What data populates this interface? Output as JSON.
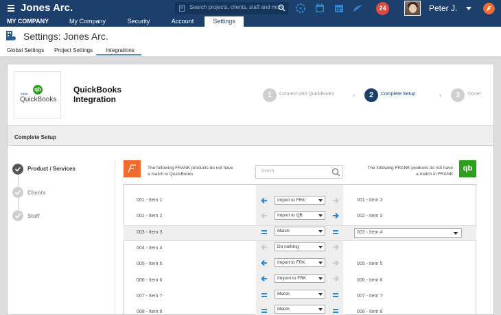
{
  "app": {
    "company_name": "Jones Arc.",
    "user_name": "Peter J.",
    "notification_count": "24"
  },
  "search": {
    "placeholder": "Search projects, clients, staff and more"
  },
  "nav": {
    "company_label": "MY COMPANY",
    "tabs": [
      {
        "label": "My Company"
      },
      {
        "label": "Security"
      },
      {
        "label": "Account"
      },
      {
        "label": "Settings",
        "active": true
      }
    ]
  },
  "page": {
    "title": "Settings: Jones Arc.",
    "subtabs": [
      {
        "label": "Global Settings"
      },
      {
        "label": "Project Settings"
      },
      {
        "label": "Integrations",
        "active": true
      }
    ]
  },
  "integration": {
    "logo_small_text": "intuit",
    "logo_text": "QuickBooks",
    "title_line1": "QuickBooks",
    "title_line2": "Integration",
    "steps": [
      {
        "number": "1",
        "label": "Connect with QuickBooks",
        "state": "done"
      },
      {
        "number": "2",
        "label": "Complete Setup",
        "state": "current"
      },
      {
        "number": "3",
        "label": "Done!",
        "state": "pending"
      }
    ]
  },
  "setup": {
    "section_title": "Complete Setup",
    "left_steps": [
      {
        "label": "Product / Services",
        "active": true
      },
      {
        "label": "Clients",
        "active": false
      },
      {
        "label": "Staff",
        "active": false
      }
    ],
    "frank_note": "The following FRANK products do not have a match in QuickBooks",
    "qb_note": "The following FRANK products do not have a match in FRANK",
    "search_placeholder": "Search",
    "rows": [
      {
        "left": "001 - Item 1",
        "action": "Import to FRK",
        "right": "001 - Item 1",
        "direction": "left"
      },
      {
        "left": "002 - Item 2",
        "action": "Import to QB",
        "right": "002 - Item 2",
        "direction": "right"
      },
      {
        "left": "003 - Item 3",
        "action": "Match",
        "right": "003 - Item 4",
        "direction": "match"
      },
      {
        "left": "004 - Item 4",
        "action": "Do nothing",
        "right": "",
        "direction": "none"
      },
      {
        "left": "005 - Item 5",
        "action": "Import to FRK",
        "right": "005 - Item 5",
        "direction": "left"
      },
      {
        "left": "006 - Item 6",
        "action": "IImport to FRK",
        "right": "006 - Item 6",
        "direction": "left"
      },
      {
        "left": "007 - Item 7",
        "action": "Match",
        "right": "007 - Item 7",
        "direction": "match"
      },
      {
        "left": "008 - Item 8",
        "action": "Match",
        "right": "008 - Item 8",
        "direction": "match"
      }
    ]
  },
  "colors": {
    "topbar": "#1d3f6b",
    "accent": "#2d86d1",
    "frank_orange": "#f26a2e",
    "qb_green": "#2ca01c"
  }
}
